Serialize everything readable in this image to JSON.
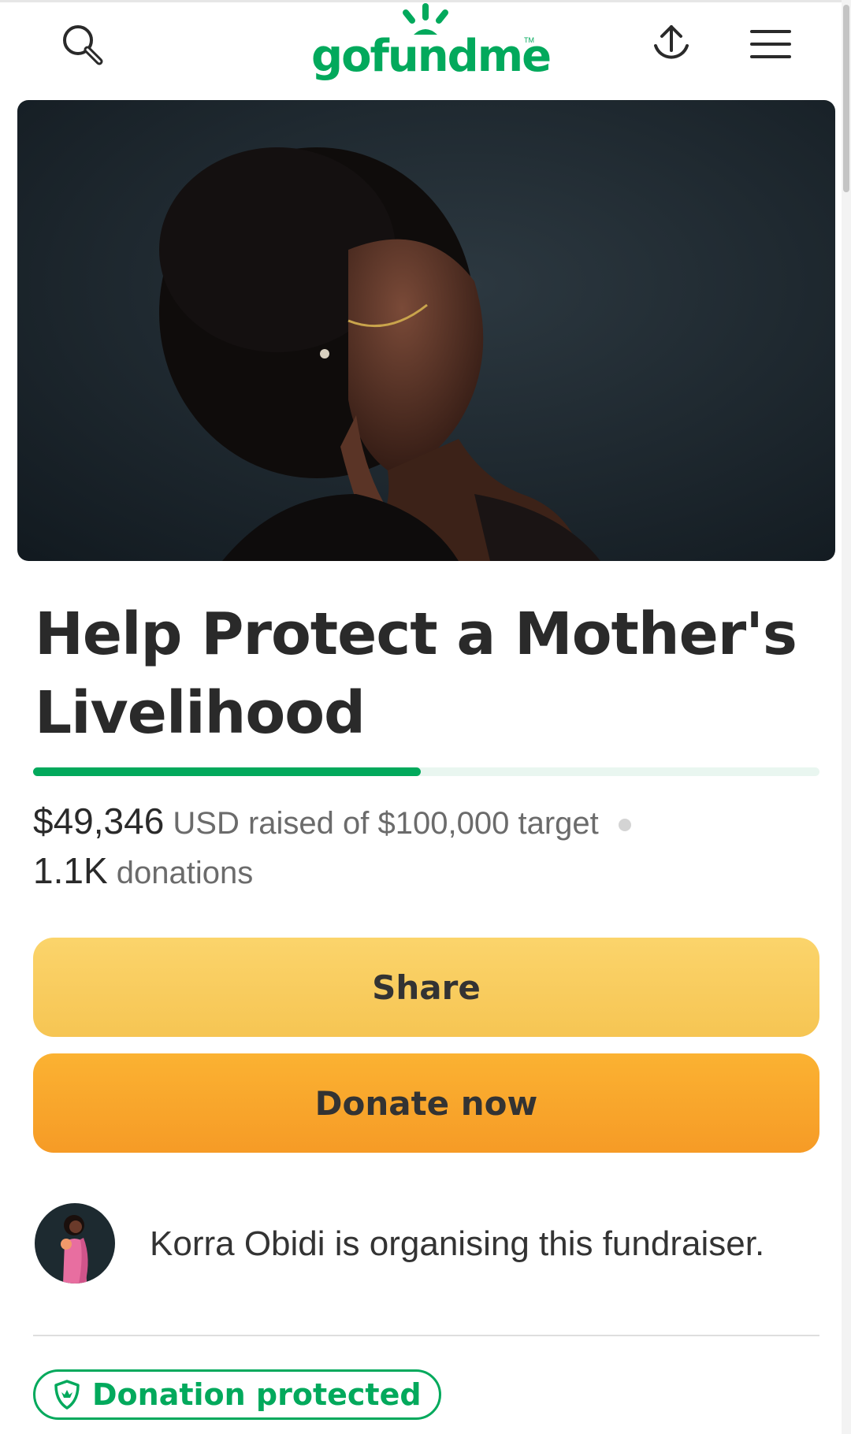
{
  "header": {
    "logo_text": "gofundme",
    "logo_tm": "TM",
    "icons": [
      "search-icon",
      "upload-icon",
      "hamburger-menu-icon"
    ]
  },
  "campaign": {
    "title": "Help Protect a Mother's Livelihood",
    "raised_amount": "$49,346",
    "raised_suffix": "USD raised of $100,000 target",
    "donation_count": "1.1K",
    "donation_label": "donations",
    "progress_fraction": 0.49346
  },
  "actions": {
    "share_label": "Share",
    "donate_label": "Donate now"
  },
  "organizer": {
    "text": "Korra Obidi is organising this fundraiser."
  },
  "badge": {
    "label": "Donation protected",
    "icon": "shield-icon"
  },
  "colors": {
    "brand_green": "#02a95c",
    "share_yellow": "#f8cc5e",
    "donate_orange": "#f9a62c",
    "title_text": "#2a2a2a"
  }
}
